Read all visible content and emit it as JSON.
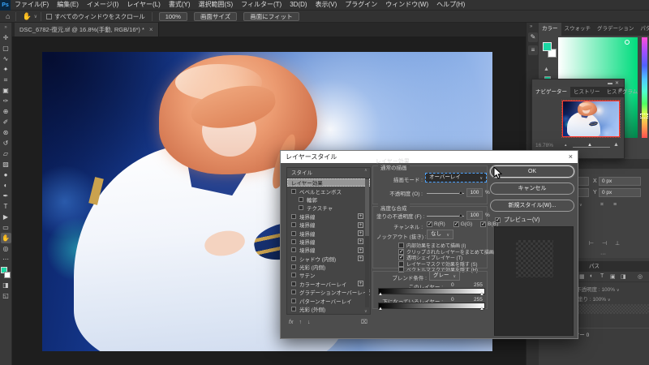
{
  "app": {
    "logo": "Ps",
    "menus": [
      "ファイル(F)",
      "編集(E)",
      "イメージ(I)",
      "レイヤー(L)",
      "書式(Y)",
      "選択範囲(S)",
      "フィルター(T)",
      "3D(D)",
      "表示(V)",
      "プラグイン",
      "ウィンドウ(W)",
      "ヘルプ(H)"
    ]
  },
  "options_bar": {
    "home_icon": "⌂",
    "hand_icon": "✋",
    "caret": "∨",
    "scroll_all_windows_label": "すべてのウィンドウをスクロール",
    "buttons": [
      "100%",
      "画面サイズ",
      "画面にフィット"
    ]
  },
  "document_tab": {
    "title": "DSC_6782-復元.tif @ 16.8%(手動, RGB/16*) *",
    "close": "×"
  },
  "toolbar": {
    "collapse": "»",
    "tools": [
      {
        "name": "move-tool",
        "glyph": "✛"
      },
      {
        "name": "marquee-tool",
        "glyph": "▢"
      },
      {
        "name": "lasso-tool",
        "glyph": "∿"
      },
      {
        "name": "quick-selection-tool",
        "glyph": "✦"
      },
      {
        "name": "crop-tool",
        "glyph": "⌗"
      },
      {
        "name": "frame-tool",
        "glyph": "▣"
      },
      {
        "name": "eyedropper-tool",
        "glyph": "✑"
      },
      {
        "name": "healing-brush-tool",
        "glyph": "⊕"
      },
      {
        "name": "brush-tool",
        "glyph": "✐"
      },
      {
        "name": "clone-stamp-tool",
        "glyph": "⊛"
      },
      {
        "name": "history-brush-tool",
        "glyph": "↺"
      },
      {
        "name": "eraser-tool",
        "glyph": "▱"
      },
      {
        "name": "gradient-tool",
        "glyph": "▨"
      },
      {
        "name": "blur-tool",
        "glyph": "●"
      },
      {
        "name": "dodge-tool",
        "glyph": "◐"
      },
      {
        "name": "pen-tool",
        "glyph": "✒"
      },
      {
        "name": "type-tool",
        "glyph": "T"
      },
      {
        "name": "path-selection-tool",
        "glyph": "▶"
      },
      {
        "name": "shape-tool",
        "glyph": "▭"
      },
      {
        "name": "hand-tool",
        "glyph": "✋",
        "active": true
      },
      {
        "name": "zoom-tool",
        "glyph": "◎"
      },
      {
        "name": "edit-toolbar",
        "glyph": "⋯"
      }
    ],
    "quick_mask_glyph": "◨",
    "screen_mode_glyph": "◱"
  },
  "dialog": {
    "title": "レイヤースタイル",
    "close": "×",
    "styles_list": {
      "header": "スタイル",
      "items": [
        {
          "label": "レイヤー効果",
          "selected": true
        },
        {
          "label": "ベベルとエンボス",
          "checkbox": true
        },
        {
          "label": "輪郭",
          "checkbox": true,
          "indent": true
        },
        {
          "label": "テクスチャ",
          "checkbox": true,
          "indent": true
        },
        {
          "label": "境界線",
          "checkbox": true,
          "plus": true
        },
        {
          "label": "境界線",
          "checkbox": true,
          "plus": true
        },
        {
          "label": "境界線",
          "checkbox": true,
          "plus": true
        },
        {
          "label": "境界線",
          "checkbox": true,
          "plus": true
        },
        {
          "label": "境界線",
          "checkbox": true,
          "plus": true
        },
        {
          "label": "シャドウ (内側)",
          "checkbox": true,
          "plus": true
        },
        {
          "label": "光彩 (内側)",
          "checkbox": true
        },
        {
          "label": "サテン",
          "checkbox": true
        },
        {
          "label": "カラーオーバーレイ",
          "checkbox": true,
          "plus": true
        },
        {
          "label": "グラデーションオーバーレイ",
          "checkbox": true,
          "plus": true
        },
        {
          "label": "パターンオーバーレイ",
          "checkbox": true
        },
        {
          "label": "光彩 (外側)",
          "checkbox": true
        }
      ],
      "footer": {
        "fx": "fx",
        "up": "↑",
        "down": "↓",
        "trash": "⌧",
        "plus_glyph": "+"
      }
    },
    "effects": {
      "section_title": "レイヤー効果",
      "general_group": "通常の描画",
      "blend_mode_label": "描画モード :",
      "blend_mode_value": "オーバーレイ",
      "opacity_label": "不透明度 (O) :",
      "opacity_value": "100",
      "percent": "%",
      "advanced_group": "高度な合成",
      "fill_opacity_label": "塗りの不透明度 (F) :",
      "fill_opacity_value": "100",
      "channels_label": "チャンネル :",
      "channels": [
        {
          "label": "R(R)",
          "checked": true
        },
        {
          "label": "G(G)",
          "checked": true
        },
        {
          "label": "B(B)",
          "checked": true
        }
      ],
      "knockout_label": "ノックアウト (抜き) :",
      "knockout_value": "なし",
      "advanced_options": [
        {
          "label": "内部効果をまとめて描画 (I)",
          "checked": false
        },
        {
          "label": "クリップされたレイヤーをまとめて描画 (C)",
          "checked": true
        },
        {
          "label": "透明シェイプレイヤー (T)",
          "checked": true
        },
        {
          "label": "レイヤーマスクで効果を隠す (S)",
          "checked": false
        },
        {
          "label": "ベクトルマスクで効果を隠す (H)",
          "checked": false
        }
      ],
      "blend_if_label": "ブレンド条件 :",
      "blend_if_value": "グレー",
      "this_layer_label": "このレイヤー :",
      "this_layer_min": "0",
      "this_layer_max": "255",
      "underlying_layer_label": "下になっているレイヤー :",
      "underlying_min": "0",
      "underlying_max": "255"
    },
    "buttons": {
      "ok": "OK",
      "cancel": "キャンセル",
      "new_style": "新規スタイル(W)...",
      "preview_label": "プレビュー(V)"
    }
  },
  "right_panels": {
    "dock_collapse": "»",
    "dock_icons": [
      {
        "name": "brush-settings-panel-icon",
        "glyph": "✎"
      },
      {
        "name": "adjustments-panel-icon",
        "glyph": "≡"
      }
    ],
    "color_panel": {
      "tabs": [
        {
          "label": "カラー",
          "active": true
        },
        {
          "label": "スウォッチ"
        },
        {
          "label": "グラデーション"
        },
        {
          "label": "パターン"
        }
      ],
      "warning_icon": "▲"
    },
    "navigator": {
      "minimize": "▬",
      "close": "✕",
      "menu_icon": "≡",
      "tabs": [
        {
          "label": "ナビゲーター",
          "active": true
        },
        {
          "label": "ヒストリー"
        },
        {
          "label": "ヒストグラム"
        }
      ],
      "zoom": "16.78%",
      "zoom_out_glyph": "▴",
      "zoom_in_glyph": "▲",
      "thumb_glyph": "▲"
    },
    "properties": {
      "x_label": "X",
      "x_value": "0 px",
      "y_label": "Y",
      "y_value": "0 px",
      "caret": "∨",
      "link_icon": "⌗",
      "ref_icon": "≡",
      "align_icons": [
        "⊢",
        "⊣",
        "⊥"
      ],
      "more": "···"
    },
    "layers": {
      "paths_tab": "パス",
      "filter_icons": [
        "▦",
        "◐",
        "T",
        "▣",
        "◨"
      ],
      "pin_icon": "◎",
      "opacity_label": "不透明度 :",
      "opacity_value": "100%",
      "caret": "∨",
      "lock_icons": [
        "⊡",
        "✛",
        "◫"
      ],
      "fill_label": "塗り :",
      "fill_value": "100%",
      "fx_icon": "⌐=",
      "layer_name": "レイヤー 0"
    }
  },
  "colors": {
    "accent_focus": "#4da3ff",
    "foreground_swatch": "#1bd6a3",
    "navigator_border": "#ff3b30",
    "logo_blue": "#37a6ff"
  }
}
